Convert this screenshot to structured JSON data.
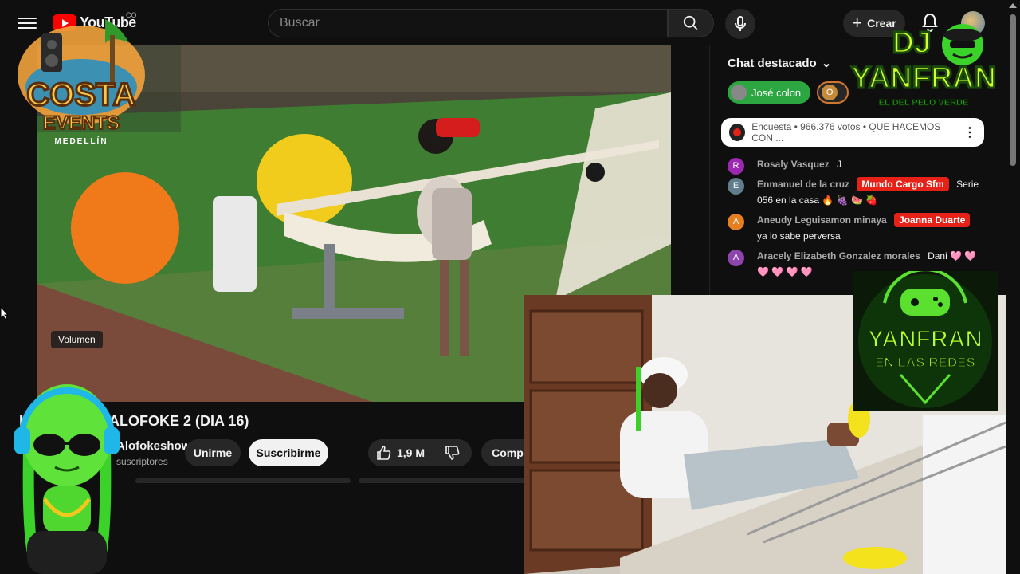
{
  "header": {
    "logo_text": "YouTube",
    "country": "CO",
    "search_placeholder": "Buscar",
    "create_label": "Crear"
  },
  "video": {
    "volume_tooltip": "Volumen",
    "title": "LA CASA DE ALOFOKE 2 (DIA 16)",
    "channel": "Alofokeshow",
    "subscribers": "suscriptores",
    "join_label": "Unirme",
    "subscribe_label": "Suscribirme",
    "likes": "1,9 M",
    "share_label": "Compartir"
  },
  "chat": {
    "header": "Chat destacado",
    "donor_chips": [
      {
        "name": "José colon",
        "color": "#2ba640"
      },
      {
        "name": "O",
        "color": "#d1762f"
      }
    ],
    "poll": "Encuesta • 966.376 votos • QUE HACEMOS CON ...",
    "messages": [
      {
        "author": "Rosaly Vasquez",
        "initial": "R",
        "color": "#9c27b0",
        "badge": "",
        "text": "J"
      },
      {
        "author": "Enmanuel de la cruz",
        "initial": "E",
        "color": "#607d8b",
        "badge": "Mundo Cargo Sfm",
        "text": "Serie 056 en la casa 🔥 🍇 🍉 🍓"
      },
      {
        "author": "Aneudy Leguisamon minaya",
        "initial": "A",
        "color": "#e67e22",
        "badge": "Joanna Duarte",
        "text": "ya lo sabe perversa"
      },
      {
        "author": "Aracely Elizabeth Gonzalez morales",
        "initial": "A",
        "color": "#8e44ad",
        "badge": "",
        "text": "Dani 🩷 🩷 🩷 🩷 🩷 🩷"
      }
    ]
  },
  "overlays": {
    "costa": {
      "line1": "COSTA",
      "line2": "EVENTS",
      "line3": "MEDELLÍN"
    },
    "dj": {
      "line1": "DJ",
      "line2": "YANFRAN",
      "line3": "EL DEL PELO VERDE"
    },
    "redes": {
      "line1": "YANFRAN",
      "line2": "EN LAS REDES"
    }
  }
}
